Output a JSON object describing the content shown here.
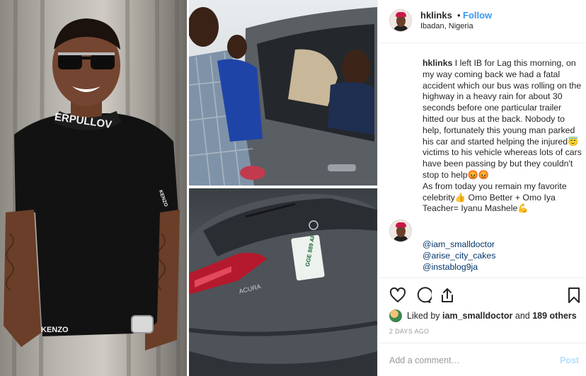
{
  "post": {
    "username": "hklinks",
    "follow_label": "Follow",
    "dot": "•",
    "location": "Ibadan, Nigeria",
    "caption_username": "hklinks",
    "caption_text": "I left IB for Lag this morning, on my way coming back we had a fatal accident which our bus was rolling on the highway in a heavy rain for about 30 seconds before one particular trailer hitted our bus at the back. Nobody to help, fortunately this young man parked his car and started helping the injured😇 victims to his vehicle whereas lots of cars have been passing by but they couldn't stop to help😡😡",
    "caption_text_2": "As from today you remain my favorite celebrity👍 Omo Better + Omo Iya Teacher= Iyanu Mashele💪",
    "tags": [
      "@iam_smalldoctor",
      "@arise_city_cakes",
      "@instablog9ja"
    ],
    "likes_prefix": "Liked by",
    "likes_user": "iam_smalldoctor",
    "likes_and": "and",
    "likes_others": "189 others",
    "time": "2 DAYS AGO",
    "comment_placeholder": "Add a comment…",
    "post_label": "Post"
  },
  "photos": {
    "shirt_text": "ERPULLOV",
    "shirt_brand": "KENZO",
    "sleeve_brand": "KENZO",
    "car_brand": "ACURA",
    "plate_text": "GGE 889 AP"
  },
  "icons": {
    "like": "heart-icon",
    "comment": "comment-icon",
    "share": "share-icon",
    "save": "bookmark-icon"
  },
  "colors": {
    "follow": "#3897f0",
    "tag": "#003569",
    "post_disabled": "#b2dffc",
    "meta": "#999999",
    "border": "#efefef"
  }
}
